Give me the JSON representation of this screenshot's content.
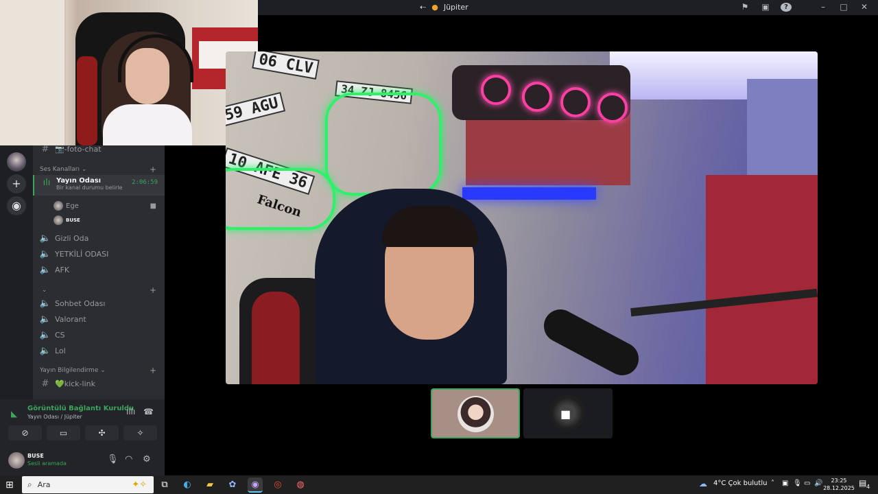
{
  "window": {
    "title": "Jüpiter"
  },
  "channels": {
    "text_channel": "📷-foto-chat",
    "voice_category": "Ses Kanalları",
    "active_voice": {
      "name": "Yayın Odası",
      "timer": "2:06:59",
      "status": "Bir kanal durumu belirle"
    },
    "members": [
      "Ege",
      "BUSE"
    ],
    "voice_channels": [
      "Gizli Oda",
      "YETKİLİ ODASI",
      "AFK"
    ],
    "category2": "",
    "voice_channels2": [
      "Sohbet Odası",
      "Valorant",
      "CS",
      "Lol"
    ],
    "stream_category": "Yayın Bilgilendirme",
    "kick_channel": "💚kick-link"
  },
  "voice_panel": {
    "status": "Görüntülü Bağlantı Kuruldu",
    "room": "Yayın Odası",
    "server": "Jüpiter"
  },
  "user_panel": {
    "name": "BUSE",
    "status": "Sesli aramada"
  },
  "main_video": {
    "plates": [
      "06 CLV",
      "34 ZJ 8456",
      "59 AGU",
      "10 AFE 36"
    ],
    "sticker_text": "Falcon"
  },
  "taskbar": {
    "search_placeholder": "Ara",
    "weather": "4°C  Çok bulutlu",
    "time": "23:25",
    "date": "28.12.2025",
    "notifications": "4"
  },
  "colors": {
    "accent_green": "#3ba55c",
    "neon_pink": "#ff3fa1",
    "neon_green": "#2ff06a",
    "background": "#000000"
  }
}
